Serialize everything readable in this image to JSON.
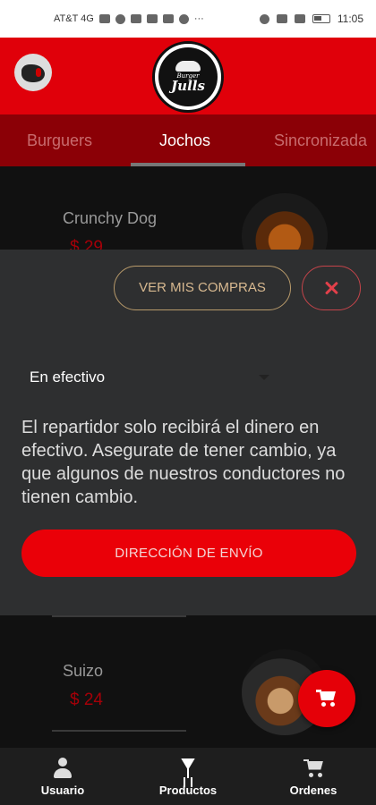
{
  "status_bar": {
    "carrier": "AT&T 4G",
    "time": "11:05"
  },
  "header": {
    "logo_small": "Burger",
    "logo_big": "Julls"
  },
  "tabs": [
    {
      "label": "Burguers"
    },
    {
      "label": "Jochos"
    },
    {
      "label": "Sincronizada"
    }
  ],
  "products": [
    {
      "name": "Crunchy Dog",
      "price": "$ 29"
    },
    {
      "name": "Suizo",
      "price": "$ 24"
    }
  ],
  "sheet": {
    "ver_compras_label": "VER MIS COMPRAS",
    "payment_method": "En efectivo",
    "note": "El repartidor solo recibirá el dinero en efectivo. Asegurate de tener cambio, ya que algunos de nuestros conductores no tienen cambio.",
    "direccion_label": "DIRECCIÓN DE ENVÍO"
  },
  "bottom_nav": [
    {
      "label": "Usuario",
      "icon": "user-icon"
    },
    {
      "label": "Productos",
      "icon": "glass-icon"
    },
    {
      "label": "Ordenes",
      "icon": "cart-icon"
    }
  ],
  "colors": {
    "brand_red": "#e0000a",
    "tab_bar": "#8b0006",
    "sheet_bg": "#2e2f30",
    "accent_gold": "#d8b990"
  }
}
